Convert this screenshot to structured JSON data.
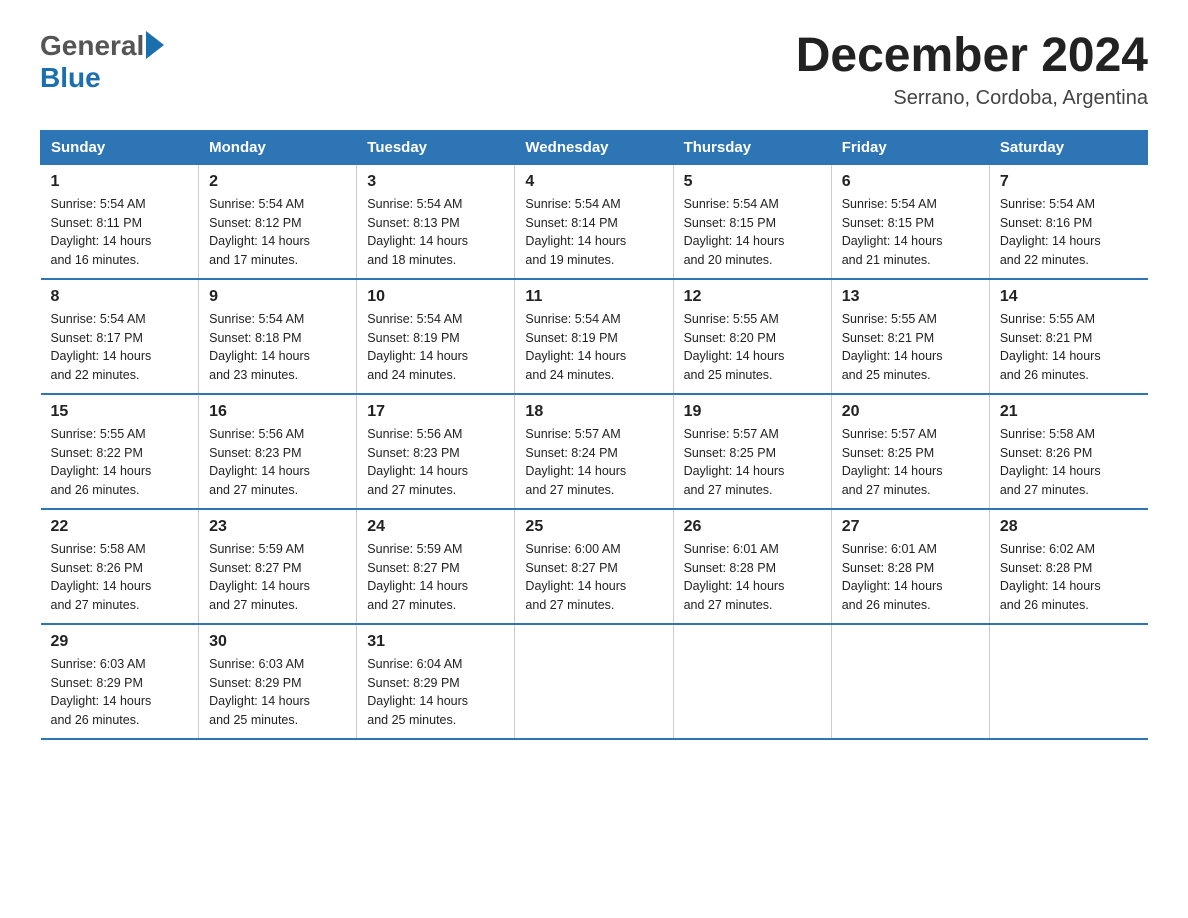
{
  "logo": {
    "general": "General",
    "blue": "Blue"
  },
  "header": {
    "month_year": "December 2024",
    "location": "Serrano, Cordoba, Argentina"
  },
  "days_of_week": [
    "Sunday",
    "Monday",
    "Tuesday",
    "Wednesday",
    "Thursday",
    "Friday",
    "Saturday"
  ],
  "weeks": [
    [
      {
        "day": "1",
        "sunrise": "5:54 AM",
        "sunset": "8:11 PM",
        "daylight": "14 hours and 16 minutes."
      },
      {
        "day": "2",
        "sunrise": "5:54 AM",
        "sunset": "8:12 PM",
        "daylight": "14 hours and 17 minutes."
      },
      {
        "day": "3",
        "sunrise": "5:54 AM",
        "sunset": "8:13 PM",
        "daylight": "14 hours and 18 minutes."
      },
      {
        "day": "4",
        "sunrise": "5:54 AM",
        "sunset": "8:14 PM",
        "daylight": "14 hours and 19 minutes."
      },
      {
        "day": "5",
        "sunrise": "5:54 AM",
        "sunset": "8:15 PM",
        "daylight": "14 hours and 20 minutes."
      },
      {
        "day": "6",
        "sunrise": "5:54 AM",
        "sunset": "8:15 PM",
        "daylight": "14 hours and 21 minutes."
      },
      {
        "day": "7",
        "sunrise": "5:54 AM",
        "sunset": "8:16 PM",
        "daylight": "14 hours and 22 minutes."
      }
    ],
    [
      {
        "day": "8",
        "sunrise": "5:54 AM",
        "sunset": "8:17 PM",
        "daylight": "14 hours and 22 minutes."
      },
      {
        "day": "9",
        "sunrise": "5:54 AM",
        "sunset": "8:18 PM",
        "daylight": "14 hours and 23 minutes."
      },
      {
        "day": "10",
        "sunrise": "5:54 AM",
        "sunset": "8:19 PM",
        "daylight": "14 hours and 24 minutes."
      },
      {
        "day": "11",
        "sunrise": "5:54 AM",
        "sunset": "8:19 PM",
        "daylight": "14 hours and 24 minutes."
      },
      {
        "day": "12",
        "sunrise": "5:55 AM",
        "sunset": "8:20 PM",
        "daylight": "14 hours and 25 minutes."
      },
      {
        "day": "13",
        "sunrise": "5:55 AM",
        "sunset": "8:21 PM",
        "daylight": "14 hours and 25 minutes."
      },
      {
        "day": "14",
        "sunrise": "5:55 AM",
        "sunset": "8:21 PM",
        "daylight": "14 hours and 26 minutes."
      }
    ],
    [
      {
        "day": "15",
        "sunrise": "5:55 AM",
        "sunset": "8:22 PM",
        "daylight": "14 hours and 26 minutes."
      },
      {
        "day": "16",
        "sunrise": "5:56 AM",
        "sunset": "8:23 PM",
        "daylight": "14 hours and 27 minutes."
      },
      {
        "day": "17",
        "sunrise": "5:56 AM",
        "sunset": "8:23 PM",
        "daylight": "14 hours and 27 minutes."
      },
      {
        "day": "18",
        "sunrise": "5:57 AM",
        "sunset": "8:24 PM",
        "daylight": "14 hours and 27 minutes."
      },
      {
        "day": "19",
        "sunrise": "5:57 AM",
        "sunset": "8:25 PM",
        "daylight": "14 hours and 27 minutes."
      },
      {
        "day": "20",
        "sunrise": "5:57 AM",
        "sunset": "8:25 PM",
        "daylight": "14 hours and 27 minutes."
      },
      {
        "day": "21",
        "sunrise": "5:58 AM",
        "sunset": "8:26 PM",
        "daylight": "14 hours and 27 minutes."
      }
    ],
    [
      {
        "day": "22",
        "sunrise": "5:58 AM",
        "sunset": "8:26 PM",
        "daylight": "14 hours and 27 minutes."
      },
      {
        "day": "23",
        "sunrise": "5:59 AM",
        "sunset": "8:27 PM",
        "daylight": "14 hours and 27 minutes."
      },
      {
        "day": "24",
        "sunrise": "5:59 AM",
        "sunset": "8:27 PM",
        "daylight": "14 hours and 27 minutes."
      },
      {
        "day": "25",
        "sunrise": "6:00 AM",
        "sunset": "8:27 PM",
        "daylight": "14 hours and 27 minutes."
      },
      {
        "day": "26",
        "sunrise": "6:01 AM",
        "sunset": "8:28 PM",
        "daylight": "14 hours and 27 minutes."
      },
      {
        "day": "27",
        "sunrise": "6:01 AM",
        "sunset": "8:28 PM",
        "daylight": "14 hours and 26 minutes."
      },
      {
        "day": "28",
        "sunrise": "6:02 AM",
        "sunset": "8:28 PM",
        "daylight": "14 hours and 26 minutes."
      }
    ],
    [
      {
        "day": "29",
        "sunrise": "6:03 AM",
        "sunset": "8:29 PM",
        "daylight": "14 hours and 26 minutes."
      },
      {
        "day": "30",
        "sunrise": "6:03 AM",
        "sunset": "8:29 PM",
        "daylight": "14 hours and 25 minutes."
      },
      {
        "day": "31",
        "sunrise": "6:04 AM",
        "sunset": "8:29 PM",
        "daylight": "14 hours and 25 minutes."
      },
      null,
      null,
      null,
      null
    ]
  ],
  "labels": {
    "sunrise": "Sunrise:",
    "sunset": "Sunset:",
    "daylight": "Daylight:"
  }
}
